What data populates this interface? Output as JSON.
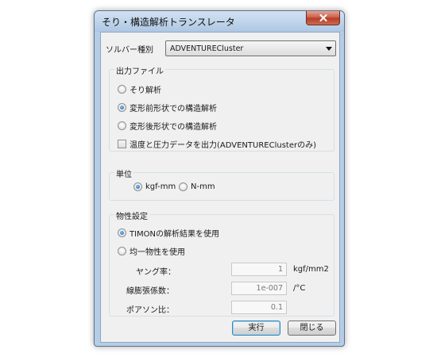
{
  "window": {
    "title": "そり・構造解析トランスレータ"
  },
  "solver": {
    "label": "ソルバー種別",
    "selected": "ADVENTURECluster"
  },
  "output": {
    "group_title": "出力ファイル",
    "options": [
      {
        "label": "そり解析",
        "selected": false
      },
      {
        "label": "変形前形状での構造解析",
        "selected": true
      },
      {
        "label": "変形後形状での構造解析",
        "selected": false
      }
    ],
    "checkbox": {
      "label": "温度と圧力データを出力(ADVENTUREClusterのみ)",
      "checked": false
    }
  },
  "units": {
    "group_title": "単位",
    "options": [
      {
        "label": "kgf-mm",
        "selected": true
      },
      {
        "label": "N-mm",
        "selected": false
      }
    ]
  },
  "material": {
    "group_title": "物性設定",
    "options": [
      {
        "label": "TIMONの解析結果を使用",
        "selected": true
      },
      {
        "label": "均一物性を使用",
        "selected": false
      }
    ],
    "young": {
      "label": "ヤング率：",
      "value": "1",
      "unit": "kgf/mm2"
    },
    "expansion": {
      "label": "線膨張係数：",
      "value": "1e-007",
      "unit": "/°C"
    },
    "poisson": {
      "label": "ポアソン比：",
      "value": "0.1"
    }
  },
  "buttons": {
    "run": "実行",
    "close": "閉じる"
  }
}
